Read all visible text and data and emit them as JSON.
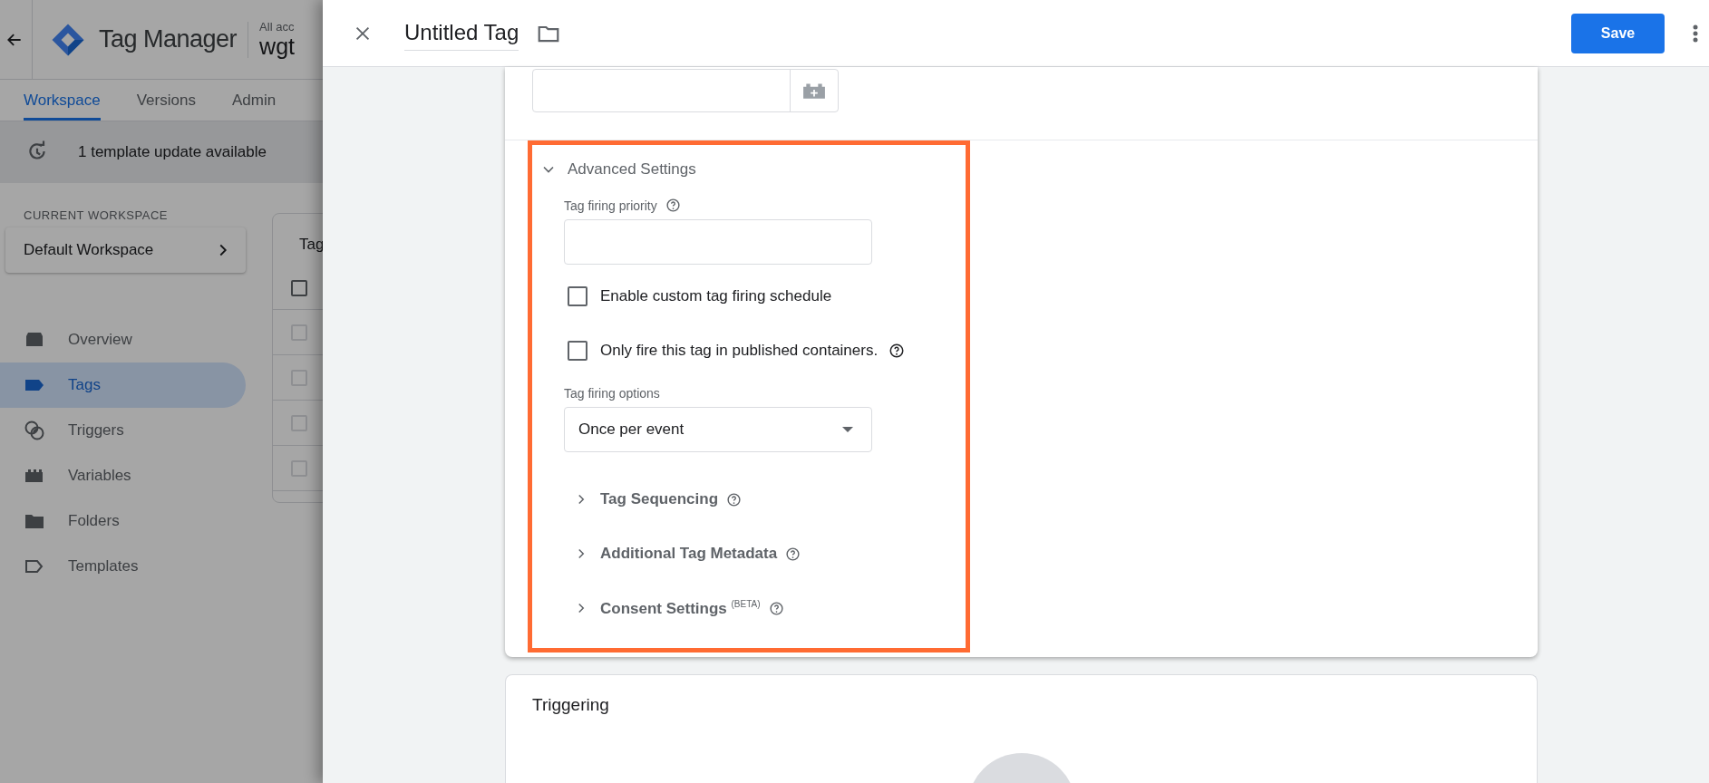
{
  "app": {
    "product": "Tag Manager",
    "account_label": "All acc",
    "container_name": "wgt",
    "tabs": [
      {
        "label": "Workspace",
        "selected": true
      },
      {
        "label": "Versions",
        "selected": false
      },
      {
        "label": "Admin",
        "selected": false
      }
    ],
    "notice": "1 template update available",
    "workspace_heading": "CURRENT WORKSPACE",
    "workspace_name": "Default Workspace",
    "nav": [
      {
        "kind": "overview",
        "label": "Overview",
        "selected": false
      },
      {
        "kind": "tags",
        "label": "Tags",
        "selected": true
      },
      {
        "kind": "triggers",
        "label": "Triggers",
        "selected": false
      },
      {
        "kind": "variables",
        "label": "Variables",
        "selected": false
      },
      {
        "kind": "folders",
        "label": "Folders",
        "selected": false
      },
      {
        "kind": "templates",
        "label": "Templates",
        "selected": false
      }
    ],
    "tags_card": {
      "title": "Tag",
      "header_checkbox": {
        "checked": false
      },
      "row_checkboxes": [
        {
          "checked": false
        },
        {
          "checked": false
        },
        {
          "checked": false
        },
        {
          "checked": false
        }
      ]
    }
  },
  "panel": {
    "title": "Untitled Tag",
    "save_label": "Save",
    "advanced": {
      "title": "Advanced Settings",
      "expanded": true,
      "priority_label": "Tag firing priority",
      "checkboxes": [
        {
          "label": "Enable custom tag firing schedule",
          "checked": false,
          "help": false
        },
        {
          "label": "Only fire this tag in published containers.",
          "checked": false,
          "help": true
        }
      ],
      "firing_options_label": "Tag firing options",
      "firing_option": "Once per event",
      "sections": [
        {
          "label": "Tag Sequencing",
          "expanded": false
        },
        {
          "label": "Additional Tag Metadata",
          "expanded": false
        },
        {
          "label": "Consent Settings $^{(BETA)}$",
          "expanded": false
        }
      ]
    },
    "triggering": {
      "title": "Triggering"
    }
  }
}
